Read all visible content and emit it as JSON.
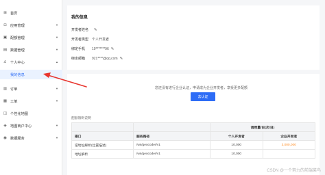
{
  "sidebar": {
    "items": [
      {
        "label": "首页",
        "icon": "grid-icon",
        "glyph": "⊞",
        "chevron": ""
      },
      {
        "label": "应用管理",
        "icon": "apps-icon",
        "glyph": "⊡",
        "chevron": "▾"
      },
      {
        "label": "配额管理",
        "icon": "quota-icon",
        "glyph": "▣",
        "chevron": "▾"
      },
      {
        "label": "数据管理",
        "icon": "data-icon",
        "glyph": "▤",
        "chevron": "▾"
      },
      {
        "label": "个人中心",
        "icon": "user-icon",
        "glyph": "♙",
        "chevron": "▴"
      },
      {
        "label": "我的信息",
        "icon": "",
        "glyph": "",
        "chevron": ""
      },
      {
        "label": "订单",
        "icon": "order-icon",
        "glyph": "▥",
        "chevron": "▾"
      },
      {
        "label": "工单",
        "icon": "ticket-icon",
        "glyph": "▦",
        "chevron": "▾"
      },
      {
        "label": "个性化地图",
        "icon": "map-style-icon",
        "glyph": "◫",
        "chevron": ""
      },
      {
        "label": "地图商户中心",
        "icon": "merchant-icon",
        "glyph": "◈",
        "chevron": "▾"
      },
      {
        "label": "数据服务",
        "icon": "service-icon",
        "glyph": "◉",
        "chevron": "▾"
      }
    ]
  },
  "profile": {
    "title": "我的信息",
    "developer_name_label": "开发者姓名",
    "developer_name_value": "",
    "developer_type_label": "开发者类型",
    "developer_type_value": "个人开发者",
    "phone_label": "绑定手机",
    "phone_value": "19*******96",
    "email_label": "绑定邮箱",
    "email_value": "921****@qq.com",
    "edit_icon": "pencil-icon"
  },
  "certification": {
    "notice": "您还没有进行企业认证，申请成为企业开发者，享受更多配额",
    "button_label": "去认证"
  },
  "quota": {
    "section_label": "配额限制说明",
    "group_header": "调用量/日(次/日)",
    "columns": [
      "接口",
      "服务路径",
      "个人开发者",
      "企业开发者"
    ],
    "rows": [
      [
        "逆地址解析(位置描述)",
        "/ws/geocoder/v1",
        "10,000",
        "3,000,000"
      ],
      [
        "地址解析",
        "/ws/geocoder/v1",
        "10,000",
        ""
      ]
    ]
  },
  "watermark": "CSDN @一个努力的前端菜鸟",
  "colors": {
    "primary": "#2d6cf6",
    "arrow": "#e8352e",
    "highlight": "#ff8a1f"
  }
}
